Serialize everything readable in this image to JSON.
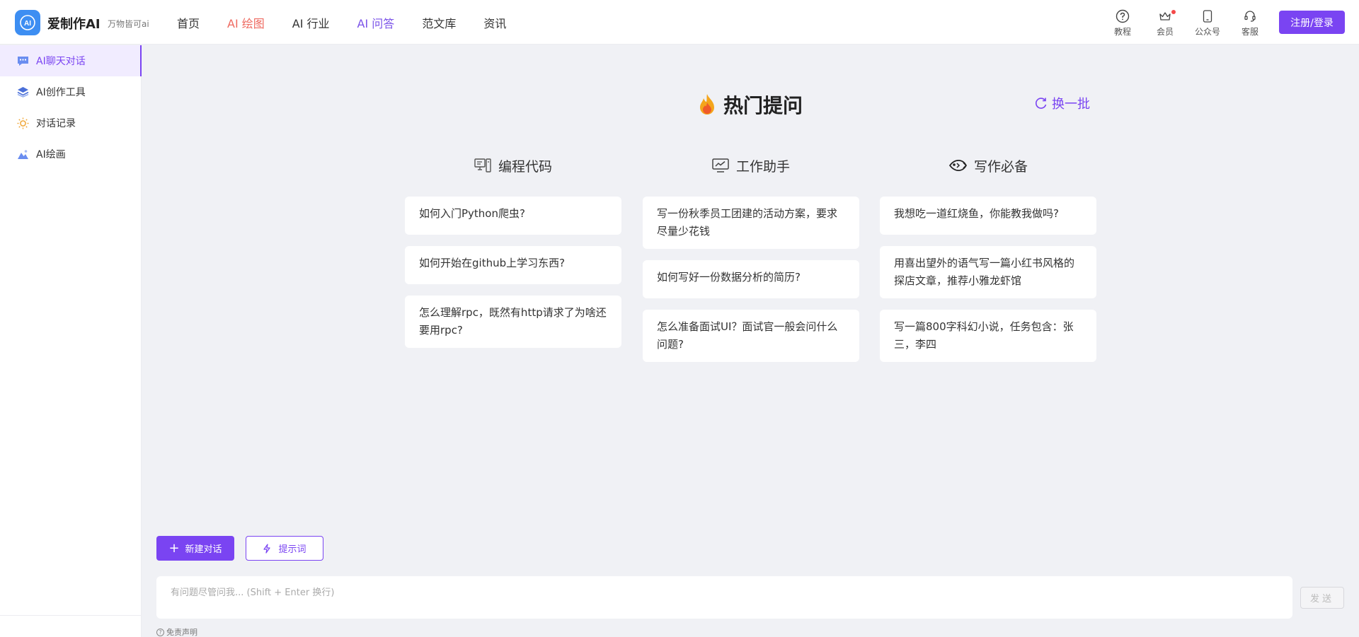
{
  "header": {
    "logo_text": "AI",
    "brand": "爱制作AI",
    "slogan": "万物皆可ai",
    "nav": [
      {
        "label": "首页",
        "color": "#333333"
      },
      {
        "label": "AI 绘图",
        "color": "#ee6a60"
      },
      {
        "label": "AI 行业",
        "color": "#333333"
      },
      {
        "label": "AI 问答",
        "color": "#7a52e8"
      },
      {
        "label": "范文库",
        "color": "#333333"
      },
      {
        "label": "资讯",
        "color": "#333333"
      }
    ],
    "tools": [
      {
        "label": "教程",
        "icon": "question-circle-icon"
      },
      {
        "label": "会员",
        "icon": "crown-icon",
        "badge_dot": true
      },
      {
        "label": "公众号",
        "icon": "phone-icon"
      },
      {
        "label": "客服",
        "icon": "headset-icon"
      }
    ],
    "login_label": "注册/登录"
  },
  "sidebar": {
    "items": [
      {
        "label": "AI聊天对话",
        "icon": "chat-icon",
        "active": true
      },
      {
        "label": "AI创作工具",
        "icon": "layers-icon",
        "active": false
      },
      {
        "label": "对话记录",
        "icon": "bulb-icon",
        "active": false
      },
      {
        "label": "AI绘画",
        "icon": "image-icon",
        "active": false
      }
    ]
  },
  "main": {
    "hot_title": "热门提问",
    "refresh_label": "换一批",
    "columns": [
      {
        "title": "编程代码",
        "icon": "code-screen-icon",
        "cards": [
          "如何入门Python爬虫?",
          "如何开始在github上学习东西?",
          "怎么理解rpc，既然有http请求了为啥还要用rpc?"
        ]
      },
      {
        "title": "工作助手",
        "icon": "monitor-chart-icon",
        "cards": [
          "写一份秋季员工团建的活动方案，要求尽量少花钱",
          "如何写好一份数据分析的简历?",
          "怎么准备面试UI？面试官一般会问什么问题?"
        ]
      },
      {
        "title": "写作必备",
        "icon": "fish-icon",
        "cards": [
          "我想吃一道红烧鱼，你能教我做吗?",
          "用喜出望外的语气写一篇小红书风格的探店文章，推荐小雅龙虾馆",
          "写一篇800字科幻小说，任务包含：张三，李四"
        ]
      }
    ]
  },
  "composer": {
    "new_chat_label": "新建对话",
    "prompt_label": "提示词",
    "input_placeholder": "有问题尽管问我... (Shift + Enter 换行)",
    "input_value": "",
    "send_label": "发送",
    "disclaimer": "免责声明"
  },
  "colors": {
    "accent": "#7a44f2",
    "brand_blue": "#3d8ef2",
    "background": "#f0f1f5"
  }
}
